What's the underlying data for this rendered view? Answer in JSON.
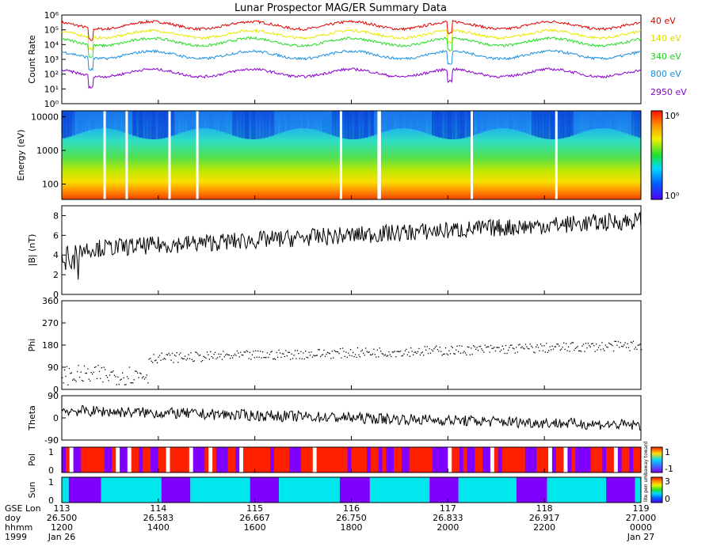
{
  "title": "Lunar Prospector MAG/ER Summary Data",
  "colors": {
    "40 eV": "#e00000",
    "140 eV": "#e8e800",
    "340 eV": "#22dd22",
    "800 eV": "#1a8fe0",
    "2950 eV": "#8a00d0",
    "pol_pos": "#ff2000",
    "pol_neg": "#8000ff",
    "sun_lit": "#00e8ee",
    "sun_dark": "#8000ff"
  },
  "chart_data": [
    {
      "type": "line",
      "ylabel": "Count Rate",
      "yscale": "log",
      "yticks": [
        "10⁰",
        "10¹",
        "10²",
        "10³",
        "10⁴",
        "10⁵",
        "10⁶"
      ],
      "ylim": [
        1,
        1000000
      ],
      "series": [
        {
          "name": "40 eV",
          "baseline": 200000
        },
        {
          "name": "140 eV",
          "baseline": 50000
        },
        {
          "name": "340 eV",
          "baseline": 15000
        },
        {
          "name": "800 eV",
          "baseline": 2000
        },
        {
          "name": "2950 eV",
          "baseline": 120
        }
      ]
    },
    {
      "type": "heatmap",
      "ylabel": "Energy (eV)",
      "yscale": "log",
      "yticks": [
        "100",
        "1000",
        "10000"
      ],
      "colorbar": {
        "scale": "log",
        "labels": [
          "10⁰",
          "10⁶"
        ]
      }
    },
    {
      "type": "line",
      "ylabel": "|B| (nT)",
      "ylim": [
        0,
        9
      ],
      "yticks": [
        "0",
        "2",
        "4",
        "6",
        "8"
      ],
      "trend_start": 4.5,
      "trend_end": 7.5
    },
    {
      "type": "scatter",
      "ylabel": "Phi",
      "ylim": [
        0,
        360
      ],
      "yticks": [
        "0",
        "90",
        "180",
        "270",
        "360"
      ],
      "trend_start": 60,
      "trend_end": 180
    },
    {
      "type": "line",
      "ylabel": "Theta",
      "ylim": [
        -90,
        90
      ],
      "yticks": [
        "-90",
        "0",
        "90"
      ]
    },
    {
      "type": "heatmap",
      "ylabel": "Pol",
      "yticks": [
        "0",
        "1"
      ],
      "colorbar": {
        "labels": [
          "1",
          "-1"
        ]
      },
      "colorbar_caption": "away toward"
    },
    {
      "type": "heatmap",
      "ylabel": "Sun",
      "yticks": [
        "0",
        "1"
      ],
      "colorbar": {
        "labels": [
          "3",
          "0"
        ]
      },
      "colorbar_caption": "lite pen umb",
      "segments": [
        [
          "lit",
          0.0,
          0.012
        ],
        [
          "dark",
          0.012,
          0.068
        ],
        [
          "lit",
          0.068,
          0.172
        ],
        [
          "dark",
          0.172,
          0.222
        ],
        [
          "lit",
          0.222,
          0.325
        ],
        [
          "dark",
          0.325,
          0.375
        ],
        [
          "lit",
          0.375,
          0.48
        ],
        [
          "dark",
          0.48,
          0.532
        ],
        [
          "lit",
          0.532,
          0.635
        ],
        [
          "dark",
          0.635,
          0.685
        ],
        [
          "lit",
          0.685,
          0.785
        ],
        [
          "dark",
          0.785,
          0.838
        ],
        [
          "lit",
          0.838,
          0.94
        ],
        [
          "dark",
          0.94,
          0.99
        ],
        [
          "lit",
          0.99,
          1.0
        ]
      ]
    }
  ],
  "xaxis": {
    "row_labels": [
      "GSE Lon",
      "doy",
      "hhmm",
      "1999"
    ],
    "ticks": [
      [
        "113",
        "26.500",
        "1200",
        "Jan 26"
      ],
      [
        "114",
        "26.583",
        "1400",
        ""
      ],
      [
        "115",
        "26.667",
        "1600",
        ""
      ],
      [
        "116",
        "26.750",
        "1800",
        ""
      ],
      [
        "117",
        "26.833",
        "2000",
        ""
      ],
      [
        "118",
        "26.917",
        "2200",
        ""
      ],
      [
        "119",
        "27.000",
        "0000",
        "Jan 27"
      ]
    ]
  }
}
